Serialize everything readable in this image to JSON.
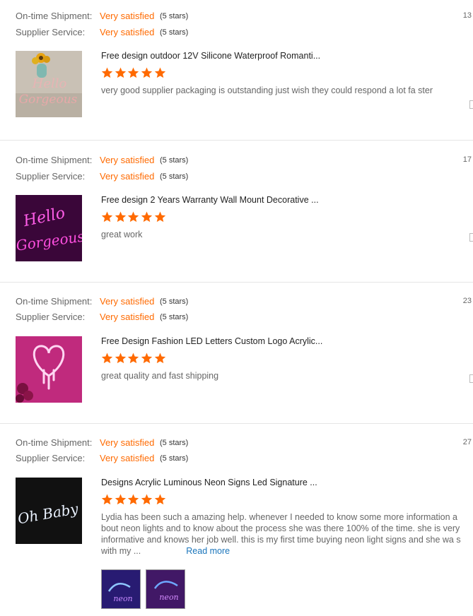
{
  "reviews": [
    {
      "shipment_label": "On-time Shipment:",
      "shipment_value": "Very satisfied",
      "shipment_stars": "(5 stars)",
      "service_label": "Supplier Service:",
      "service_value": "Very satisfied",
      "service_stars": "(5 stars)",
      "date": "13",
      "product_title": "Free design outdoor 12V Silicone Waterproof Romanti...",
      "product_rating": 5,
      "body": "very good supplier packaging is outstanding just wish they could respond a lot fa ster",
      "thumbnail": "hello-gorgeous-sign-image"
    },
    {
      "shipment_label": "On-time Shipment:",
      "shipment_value": "Very satisfied",
      "shipment_stars": "(5 stars)",
      "service_label": "Supplier Service:",
      "service_value": "Very satisfied",
      "service_stars": "(5 stars)",
      "date": "17",
      "product_title": "Free design 2 Years Warranty Wall Mount Decorative ...",
      "product_rating": 5,
      "body": "great work",
      "thumbnail": "hello-gorgeous-pink-neon-image"
    },
    {
      "shipment_label": "On-time Shipment:",
      "shipment_value": "Very satisfied",
      "shipment_stars": "(5 stars)",
      "service_label": "Supplier Service:",
      "service_value": "Very satisfied",
      "service_stars": "(5 stars)",
      "date": "23",
      "product_title": "Free Design Fashion LED Letters Custom Logo Acrylic...",
      "product_rating": 5,
      "body": "great quality and fast shipping",
      "thumbnail": "dripping-heart-neon-image"
    },
    {
      "shipment_label": "On-time Shipment:",
      "shipment_value": "Very satisfied",
      "shipment_stars": "(5 stars)",
      "service_label": "Supplier Service:",
      "service_value": "Very satisfied",
      "service_stars": "(5 stars)",
      "date": "27",
      "product_title": "Designs Acrylic Luminous Neon Signs Led Signature ...",
      "product_rating": 5,
      "body": "Lydia has been such a amazing help.  whenever I needed to know some more information a bout neon lights and to know about the process she was there 100% of the time. she is very informative and knows her job well. this is my first time buying neon  light signs and she wa s with my ...",
      "read_more": "Read more",
      "thumbnail": "oh-baby-neon-image"
    }
  ],
  "colors": {
    "accent_orange": "#ff6a00",
    "link_blue": "#1a75bb",
    "star_orange": "#ff6a00"
  }
}
